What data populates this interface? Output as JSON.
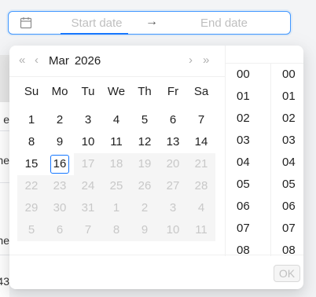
{
  "range": {
    "start_placeholder": "Start date",
    "end_placeholder": "End date",
    "separator": "→"
  },
  "calendar": {
    "month": "Mar",
    "year": "2026",
    "weekdays": [
      "Su",
      "Mo",
      "Tu",
      "We",
      "Th",
      "Fr",
      "Sa"
    ],
    "days": [
      {
        "d": "1"
      },
      {
        "d": "2"
      },
      {
        "d": "3"
      },
      {
        "d": "4"
      },
      {
        "d": "5"
      },
      {
        "d": "6"
      },
      {
        "d": "7"
      },
      {
        "d": "8"
      },
      {
        "d": "9"
      },
      {
        "d": "10"
      },
      {
        "d": "11"
      },
      {
        "d": "12"
      },
      {
        "d": "13"
      },
      {
        "d": "14"
      },
      {
        "d": "15"
      },
      {
        "d": "16",
        "today": true
      },
      {
        "d": "17",
        "disabled": true
      },
      {
        "d": "18",
        "disabled": true
      },
      {
        "d": "19",
        "disabled": true
      },
      {
        "d": "20",
        "disabled": true
      },
      {
        "d": "21",
        "disabled": true
      },
      {
        "d": "22",
        "disabled": true
      },
      {
        "d": "23",
        "disabled": true
      },
      {
        "d": "24",
        "disabled": true
      },
      {
        "d": "25",
        "disabled": true
      },
      {
        "d": "26",
        "disabled": true
      },
      {
        "d": "27",
        "disabled": true
      },
      {
        "d": "28",
        "disabled": true
      },
      {
        "d": "29",
        "disabled": true
      },
      {
        "d": "30",
        "disabled": true
      },
      {
        "d": "31",
        "disabled": true
      },
      {
        "d": "1",
        "disabled": true
      },
      {
        "d": "2",
        "disabled": true
      },
      {
        "d": "3",
        "disabled": true
      },
      {
        "d": "4",
        "disabled": true
      },
      {
        "d": "5",
        "disabled": true
      },
      {
        "d": "6",
        "disabled": true
      },
      {
        "d": "7",
        "disabled": true
      },
      {
        "d": "8",
        "disabled": true
      },
      {
        "d": "9",
        "disabled": true
      },
      {
        "d": "10",
        "disabled": true
      },
      {
        "d": "11",
        "disabled": true
      }
    ]
  },
  "time": {
    "hours": [
      "00",
      "01",
      "02",
      "03",
      "04",
      "05",
      "06",
      "07",
      "08"
    ],
    "minutes": [
      "00",
      "01",
      "02",
      "03",
      "04",
      "05",
      "06",
      "07",
      "08"
    ]
  },
  "footer": {
    "ok_label": "OK"
  },
  "background": {
    "cells": [
      "e",
      "ne",
      "ne",
      "43"
    ]
  },
  "colors": {
    "primary": "#1677ff",
    "disabled_bg": "#f5f5f5",
    "disabled_text": "#c8c8c8"
  }
}
